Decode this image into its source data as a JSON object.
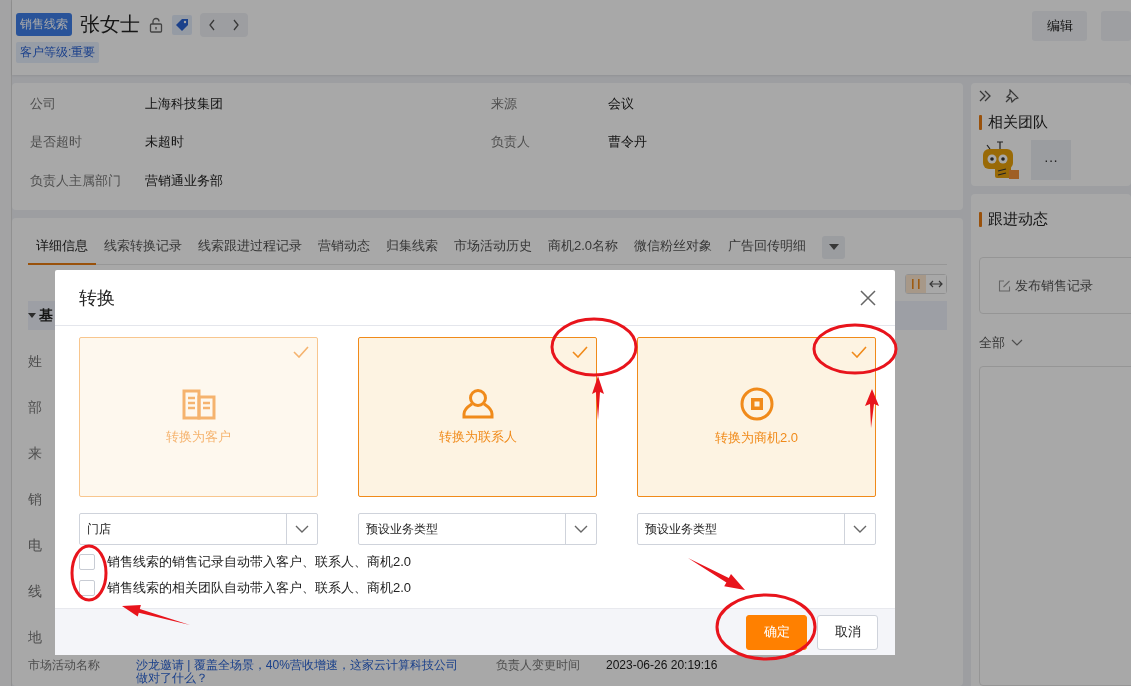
{
  "header": {
    "record_type": "销售线索",
    "title": "张女士",
    "level_tag": "客户等级:重要",
    "buttons": [
      "编辑"
    ]
  },
  "summary": {
    "fields": [
      {
        "label": "公司",
        "value": "上海科技集团"
      },
      {
        "label": "来源",
        "value": "会议"
      },
      {
        "label": "是否超时",
        "value": "未超时"
      },
      {
        "label": "负责人",
        "value": "曹令丹"
      },
      {
        "label": "负责人主属部门",
        "value": "营销通业务部"
      }
    ]
  },
  "tabs": [
    {
      "label": "详细信息",
      "selected": true
    },
    {
      "label": "线索转换记录",
      "selected": false
    },
    {
      "label": "线索跟进过程记录",
      "selected": false
    },
    {
      "label": "营销动态",
      "selected": false
    },
    {
      "label": "归集线索",
      "selected": false
    },
    {
      "label": "市场活动历史",
      "selected": false
    },
    {
      "label": "商机2.0名称",
      "selected": false
    },
    {
      "label": "微信粉丝对象",
      "selected": false
    },
    {
      "label": "广告回传明细",
      "selected": false
    }
  ],
  "section_header": "基",
  "detail_labels": [
    "姓",
    "部",
    "来",
    "销",
    "电",
    "线",
    "地"
  ],
  "bottom_row": {
    "label": "市场活动名称",
    "link": "沙龙邀请 | 覆盖全场景，40%营收增速，这家云计算科技公司做对了什么？",
    "label_2": "负责人变更时间",
    "value_2": "2023-06-26 20:19:16"
  },
  "related_team": {
    "title": "相关团队",
    "more_button": "···"
  },
  "follow_up": {
    "title": "跟进动态",
    "post_button": "发布销售记录",
    "filter": "全部"
  },
  "modal": {
    "title": "转换",
    "cards": [
      {
        "kind": "customer",
        "label": "转换为客户",
        "selected": true,
        "disabled": true,
        "select_value": "门店"
      },
      {
        "kind": "contact",
        "label": "转换为联系人",
        "selected": true,
        "disabled": false,
        "select_value": "预设业务类型"
      },
      {
        "kind": "opportunity",
        "label": "转换为商机2.0",
        "selected": true,
        "disabled": false,
        "select_value": "预设业务类型"
      }
    ],
    "options": [
      {
        "label": "销售线索的销售记录自动带入客户、联系人、商机2.0",
        "checked": false
      },
      {
        "label": "销售线索的相关团队自动带入客户、联系人、商机2.0",
        "checked": false
      }
    ],
    "buttons": [
      {
        "label": "确定",
        "kind": "primary"
      },
      {
        "label": "取消",
        "kind": "default"
      }
    ]
  }
}
